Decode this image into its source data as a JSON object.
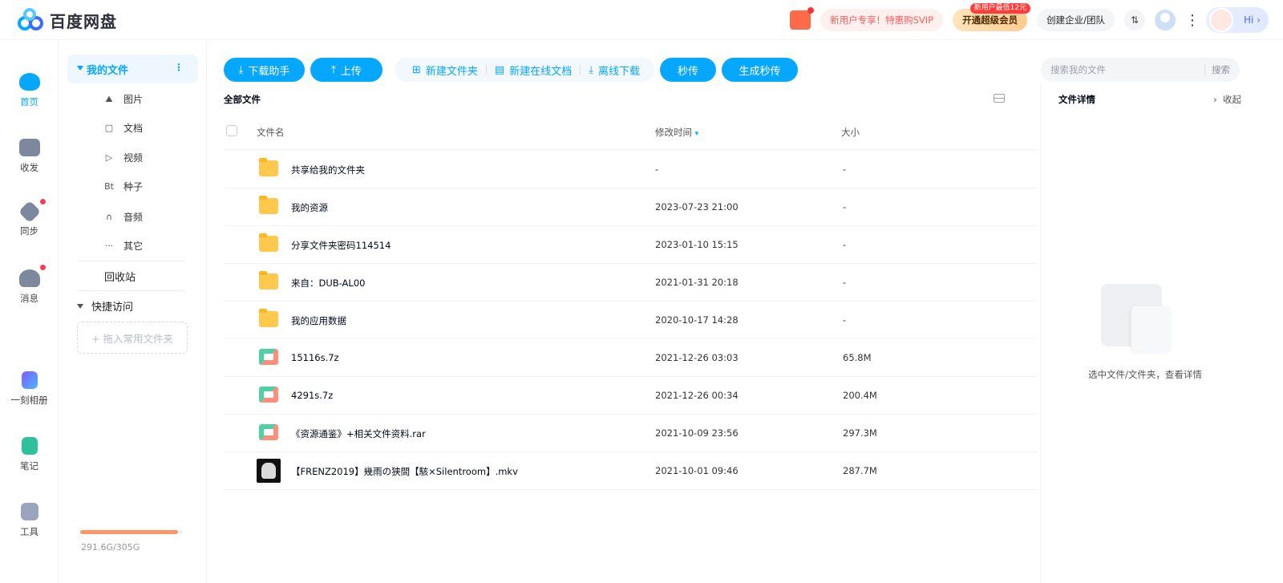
{
  "app": {
    "title": "百度网盘"
  },
  "header": {
    "promo": "新用户专享！特惠购SVIP",
    "vip_button": "开通超级会员",
    "vip_tag": "新用户最低12元",
    "org_button": "创建企业/团队",
    "transfer_glyph": "⇅",
    "more_glyph": "⋮",
    "hi_label": "Hi ›"
  },
  "rail": [
    {
      "label": "首页",
      "icon": "cloud-home-icon",
      "active": true
    },
    {
      "label": "收发",
      "icon": "folder-share-icon"
    },
    {
      "label": "同步",
      "icon": "sync-icon",
      "badge": true
    },
    {
      "label": "消息",
      "icon": "people-icon",
      "badge": true
    },
    {
      "label": "一刻相册",
      "icon": "album-icon"
    },
    {
      "label": "笔记",
      "icon": "note-icon"
    },
    {
      "label": "工具",
      "icon": "tools-icon"
    }
  ],
  "subnav": {
    "my_files": "我的文件",
    "more_glyph": "⋮",
    "categories": [
      {
        "label": "图片",
        "glyph": "⛰"
      },
      {
        "label": "文档",
        "glyph": "▢"
      },
      {
        "label": "视频",
        "glyph": "▷"
      },
      {
        "label": "种子",
        "glyph": "Bt"
      },
      {
        "label": "音频",
        "glyph": "∩"
      },
      {
        "label": "其它",
        "glyph": "···"
      }
    ],
    "recycle": "回收站",
    "quick_access": "快捷访问",
    "drop_hint": "+ 拖入常用文件夹",
    "quota_text": "291.6G/305G",
    "quota_used_fraction": 0.956
  },
  "toolbar": {
    "download_helper": "下载助手",
    "upload": "上传",
    "new_folder": "新建文件夹",
    "new_online_doc": "新建在线文档",
    "offline_download": "离线下载",
    "instant": "秒传",
    "gen_instant": "生成秒传"
  },
  "search": {
    "placeholder": "搜索我的文件",
    "button": "搜索"
  },
  "list": {
    "breadcrumb": "全部文件",
    "columns": {
      "name": "文件名",
      "time": "修改时间",
      "size": "大小"
    },
    "rows": [
      {
        "name": "共享给我的文件夹",
        "time": "-",
        "size": "-",
        "type": "shared-folder"
      },
      {
        "name": "我的资源",
        "time": "2023-07-23 21:00",
        "size": "-",
        "type": "folder"
      },
      {
        "name": "分享文件夹密码114514",
        "time": "2023-01-10 15:15",
        "size": "-",
        "type": "folder"
      },
      {
        "name": "来自：DUB-AL00",
        "time": "2021-01-31 20:18",
        "size": "-",
        "type": "folder"
      },
      {
        "name": "我的应用数据",
        "time": "2020-10-17 14:28",
        "size": "-",
        "type": "folder"
      },
      {
        "name": "15116s.7z",
        "time": "2021-12-26 03:03",
        "size": "65.8M",
        "type": "archive"
      },
      {
        "name": "4291s.7z",
        "time": "2021-12-26 00:34",
        "size": "200.4M",
        "type": "archive"
      },
      {
        "name": "《资源通鉴》+相关文件资料.rar",
        "time": "2021-10-09 23:56",
        "size": "297.3M",
        "type": "archive"
      },
      {
        "name": "【FRENZ2019】幾雨の狭間【駭×Silentroom】.mkv",
        "time": "2021-10-01 09:46",
        "size": "287.7M",
        "type": "video"
      }
    ]
  },
  "detail": {
    "title": "文件详情",
    "collapse": "收起",
    "empty_hint": "选中文件/文件夹，查看详情"
  },
  "colors": {
    "accent": "#06a7ff",
    "folder": "#ffc94d",
    "quota": "#ff9466"
  }
}
